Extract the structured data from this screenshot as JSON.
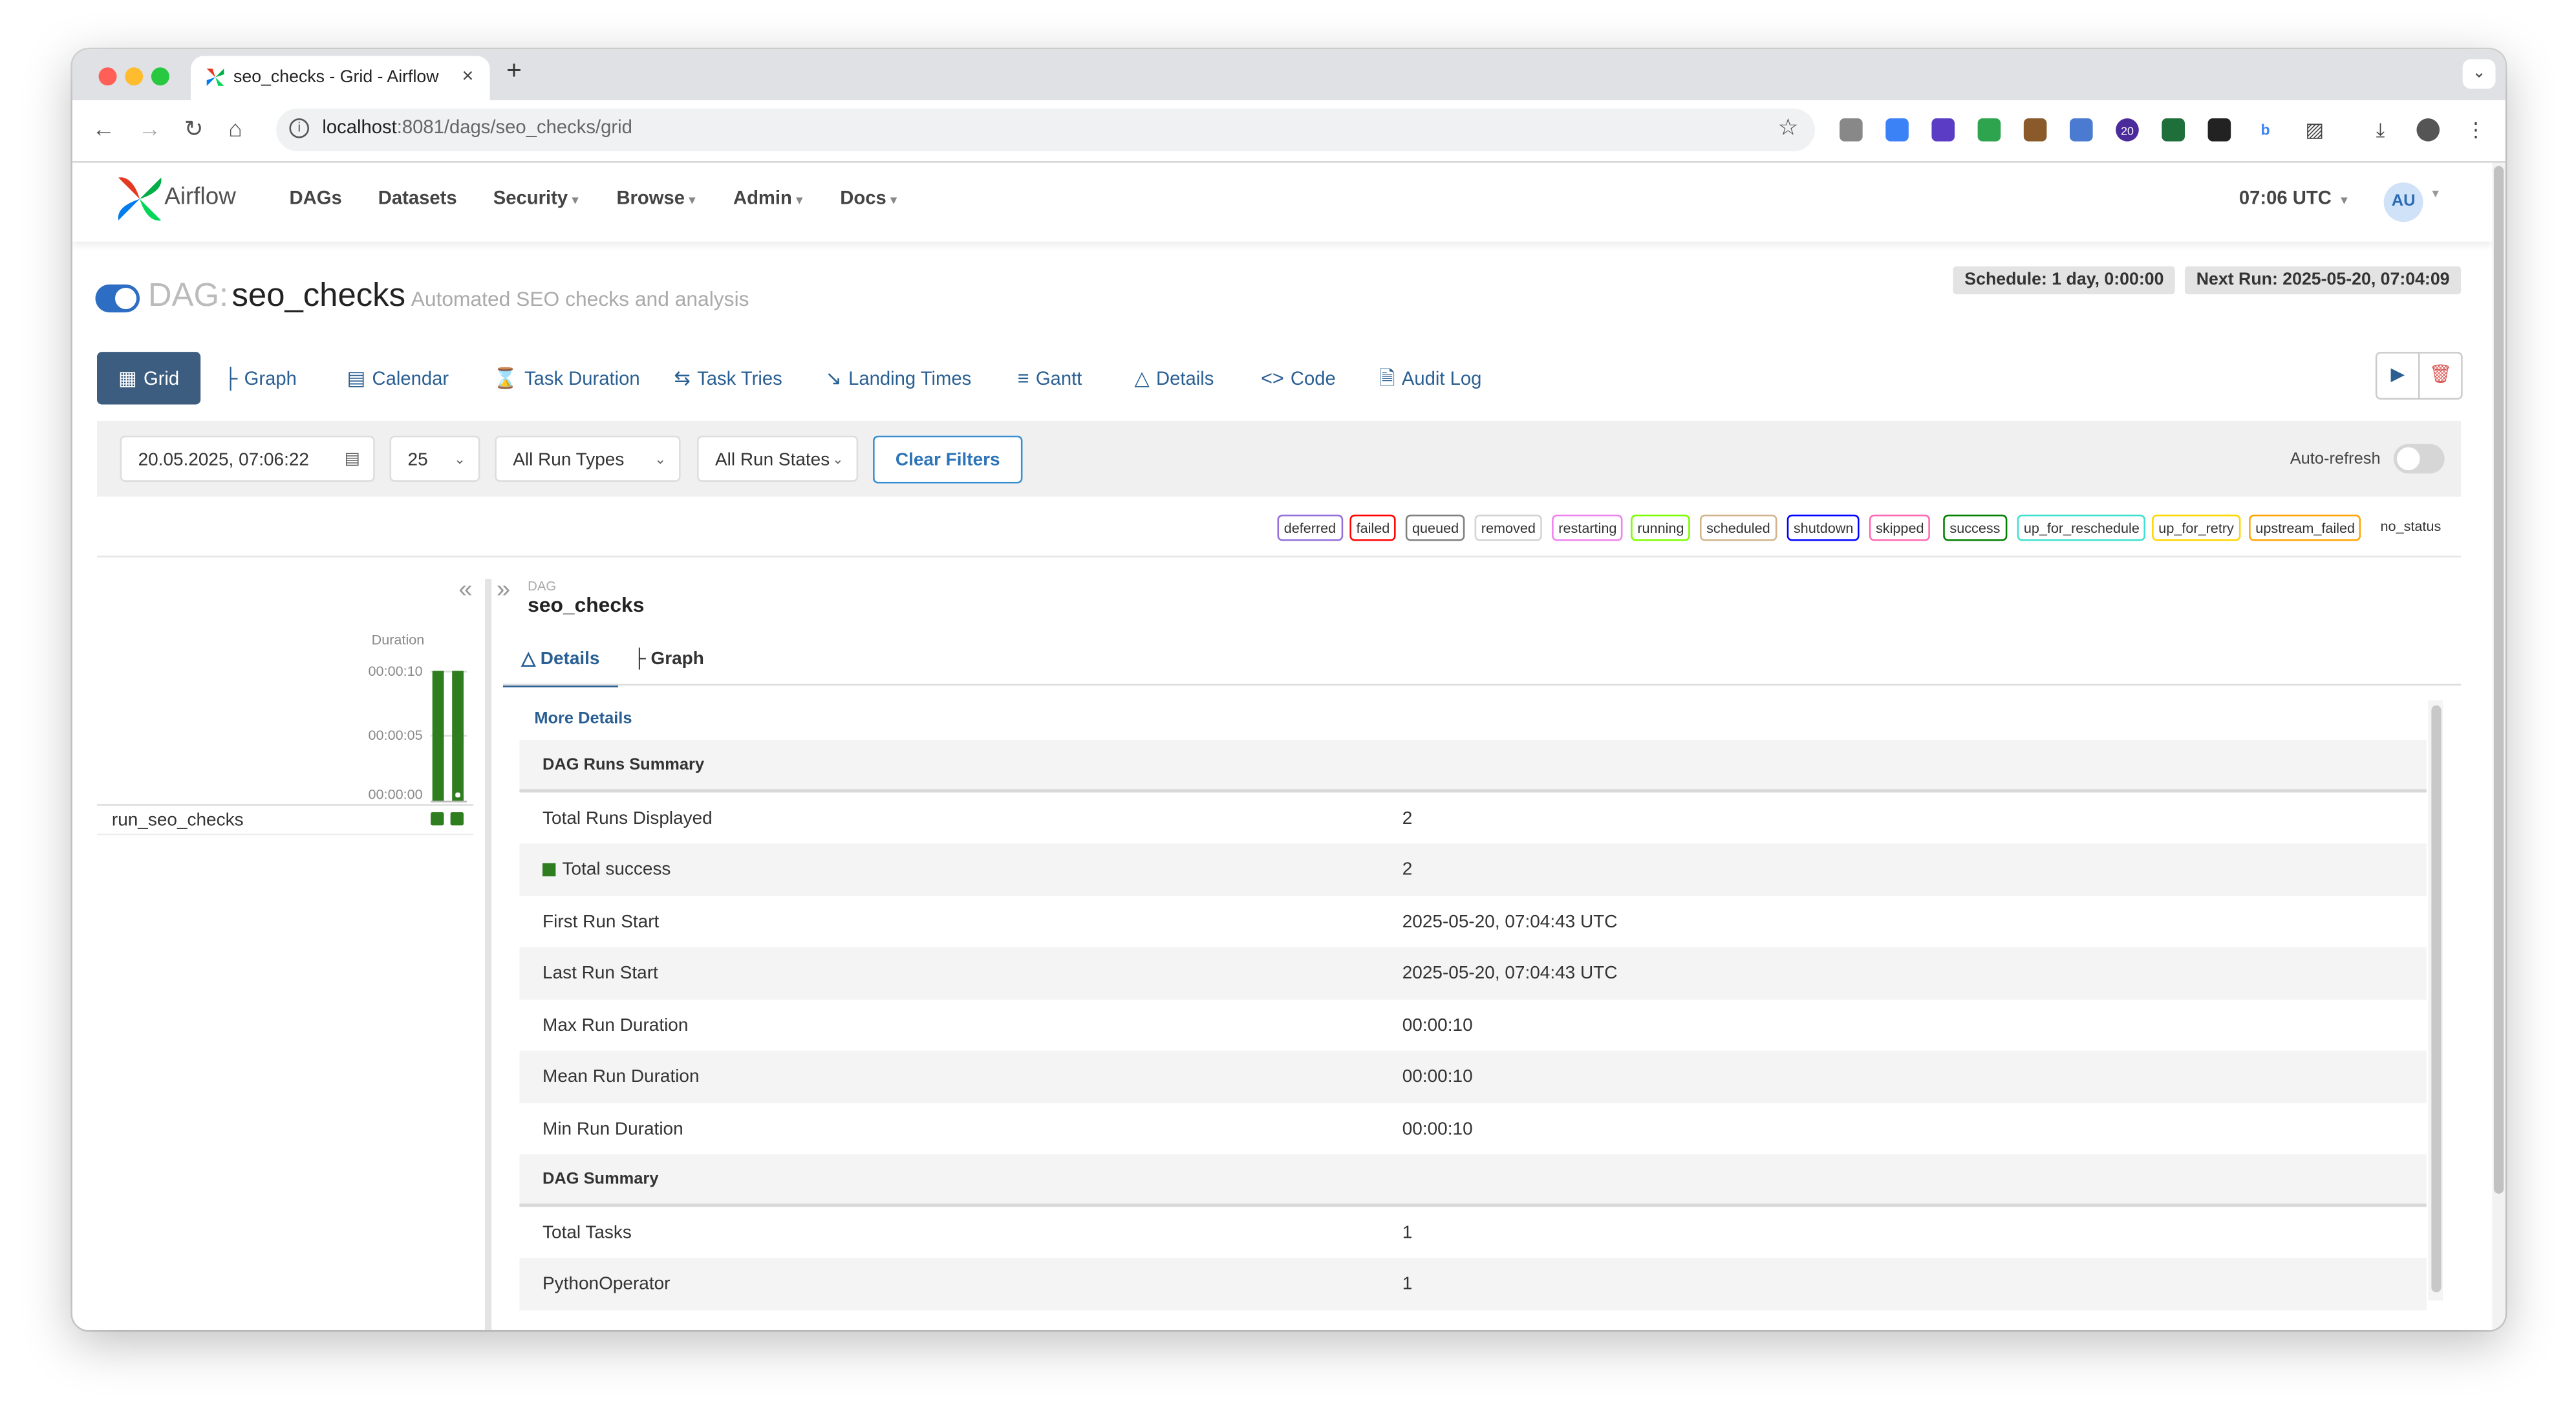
{
  "browser": {
    "tab_title": "seo_checks - Grid - Airflow",
    "tab_close": "×",
    "new_tab": "+",
    "url_host": "localhost",
    "url_rest": ":8081/dags/seo_checks/grid",
    "extension_badge": "20",
    "tabmenu_glyph": "⌄"
  },
  "nav": {
    "brand": "Airflow",
    "menu": [
      "DAGs",
      "Datasets",
      "Security",
      "Browse",
      "Admin",
      "Docs"
    ],
    "time": "07:06 UTC",
    "avatar": "AU"
  },
  "dag": {
    "prefix": "DAG:",
    "name": "seo_checks",
    "description": "Automated SEO checks and analysis",
    "schedule": "Schedule: 1 day, 0:00:00",
    "next_run": "Next Run: 2025-05-20, 07:04:09",
    "paused": false
  },
  "view_tabs": [
    "Grid",
    "Graph",
    "Calendar",
    "Task Duration",
    "Task Tries",
    "Landing Times",
    "Gantt",
    "Details",
    "Code",
    "Audit Log"
  ],
  "filters": {
    "date": "20.05.2025, 07:06:22",
    "num_runs": "25",
    "run_types": "All Run Types",
    "run_states": "All Run States",
    "clear": "Clear Filters",
    "auto_refresh_label": "Auto-refresh",
    "auto_refresh_on": false
  },
  "legend": [
    {
      "label": "deferred",
      "color": "#9370db"
    },
    {
      "label": "failed",
      "color": "#ff0000"
    },
    {
      "label": "queued",
      "color": "#808080"
    },
    {
      "label": "removed",
      "color": "#d3d3d3"
    },
    {
      "label": "restarting",
      "color": "#ee82ee"
    },
    {
      "label": "running",
      "color": "#7cfc00"
    },
    {
      "label": "scheduled",
      "color": "#d2b48c"
    },
    {
      "label": "shutdown",
      "color": "#0000ff"
    },
    {
      "label": "skipped",
      "color": "#ff69b4"
    },
    {
      "label": "success",
      "color": "#008000"
    },
    {
      "label": "up_for_reschedule",
      "color": "#40e0d0"
    },
    {
      "label": "up_for_retry",
      "color": "#ffd700"
    },
    {
      "label": "upstream_failed",
      "color": "#ffa500"
    },
    {
      "label": "no_status",
      "color": ""
    }
  ],
  "grid": {
    "duration_label": "Duration",
    "ticks": [
      "00:00:10",
      "00:00:05",
      "00:00:00"
    ],
    "run_durations_fraction": [
      1.0,
      1.0
    ],
    "task_name": "run_seo_checks",
    "success_color": "#2e7d1f"
  },
  "panel": {
    "dag_small": "DAG",
    "dag_name": "seo_checks",
    "tabs": [
      "Details",
      "Graph"
    ],
    "more_details": "More Details",
    "rows": [
      {
        "type": "head",
        "label": "DAG Runs Summary",
        "value": ""
      },
      {
        "type": "row",
        "label": "Total Runs Displayed",
        "value": "2"
      },
      {
        "type": "row",
        "label": "Total success",
        "value": "2",
        "marker": true
      },
      {
        "type": "row",
        "label": "First Run Start",
        "value": "2025-05-20, 07:04:43 UTC"
      },
      {
        "type": "row",
        "label": "Last Run Start",
        "value": "2025-05-20, 07:04:43 UTC"
      },
      {
        "type": "row",
        "label": "Max Run Duration",
        "value": "00:00:10"
      },
      {
        "type": "row",
        "label": "Mean Run Duration",
        "value": "00:00:10"
      },
      {
        "type": "row",
        "label": "Min Run Duration",
        "value": "00:00:10"
      },
      {
        "type": "head",
        "label": "DAG Summary",
        "value": ""
      },
      {
        "type": "row",
        "label": "Total Tasks",
        "value": "1"
      },
      {
        "type": "row",
        "label": "PythonOperator",
        "value": "1"
      }
    ]
  },
  "icons": {
    "back": "back-arrow-icon",
    "forward": "forward-arrow-icon",
    "reload": "reload-icon",
    "home": "home-icon",
    "star": "star-icon",
    "play": "play-icon",
    "delete": "trash-icon"
  }
}
